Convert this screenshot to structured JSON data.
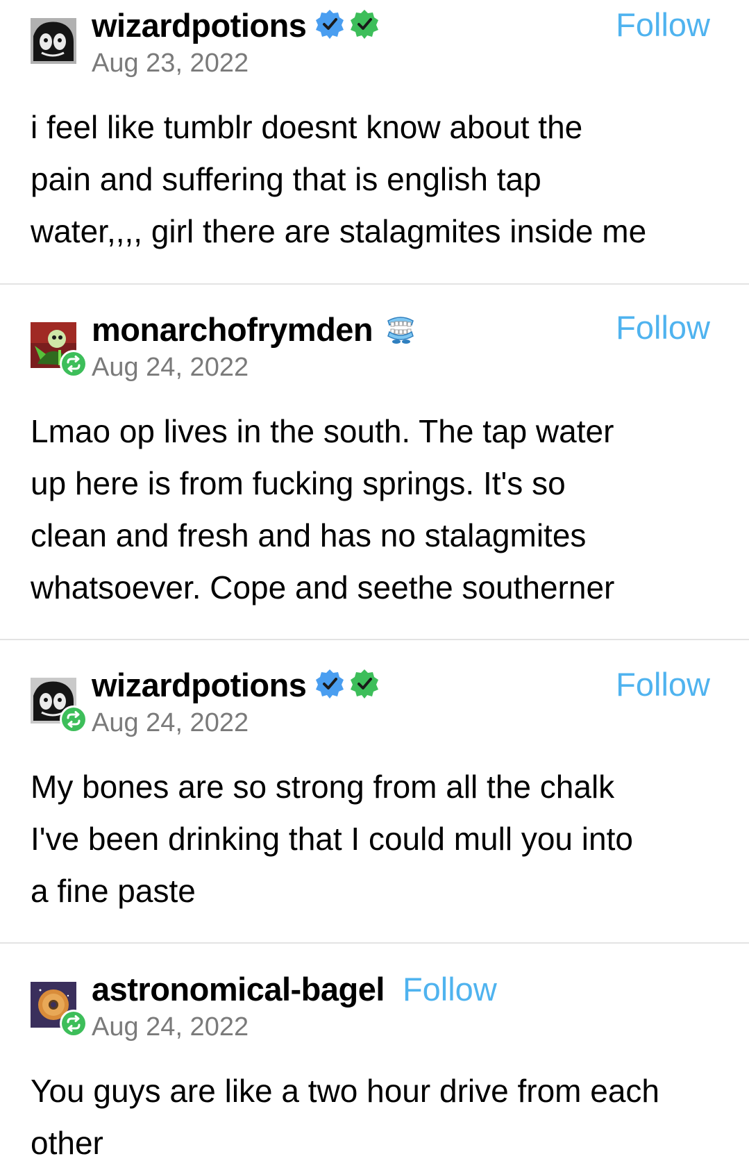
{
  "colors": {
    "follow": "#4fb3ef",
    "date": "#7a7a7a",
    "text": "#000000",
    "divider": "#e3e3e3",
    "verified_blue": "#4a9ef0",
    "verified_green": "#3dbe5a",
    "reblog_green": "#3dbe5a"
  },
  "posts": [
    {
      "username": "wizardpotions",
      "badges": [
        "verified-blue-badge-icon",
        "verified-green-badge-icon"
      ],
      "follow_label": "Follow",
      "date": "Aug 23, 2022",
      "reblog_icon": null,
      "body_lines": [
        "i feel like tumblr doesnt know about the",
        "pain and suffering that is english tap",
        "water,,,, girl there are stalagmites inside me"
      ]
    },
    {
      "username": "monarchofrymden",
      "badges": [
        "chattering-teeth-badge-icon"
      ],
      "follow_label": "Follow",
      "date": "Aug 24, 2022",
      "reblog_icon": "reblog-icon",
      "body_lines": [
        "Lmao op lives in the south. The tap water",
        "up here is from fucking springs. It's so",
        "clean and fresh and has no stalagmites",
        "whatsoever. Cope and seethe southerner"
      ]
    },
    {
      "username": "wizardpotions",
      "badges": [
        "verified-blue-badge-icon",
        "verified-green-badge-icon"
      ],
      "follow_label": "Follow",
      "date": "Aug 24, 2022",
      "reblog_icon": "reblog-icon",
      "body_lines": [
        "My bones are so strong from all the chalk",
        "I've been drinking that I could mull you into",
        "a fine paste"
      ]
    },
    {
      "username": "astronomical-bagel",
      "badges": [],
      "follow_label": "Follow",
      "date": "Aug 24, 2022",
      "reblog_icon": "reblog-icon",
      "body_lines": [
        "You guys are like a two hour drive from each",
        "other"
      ]
    }
  ]
}
